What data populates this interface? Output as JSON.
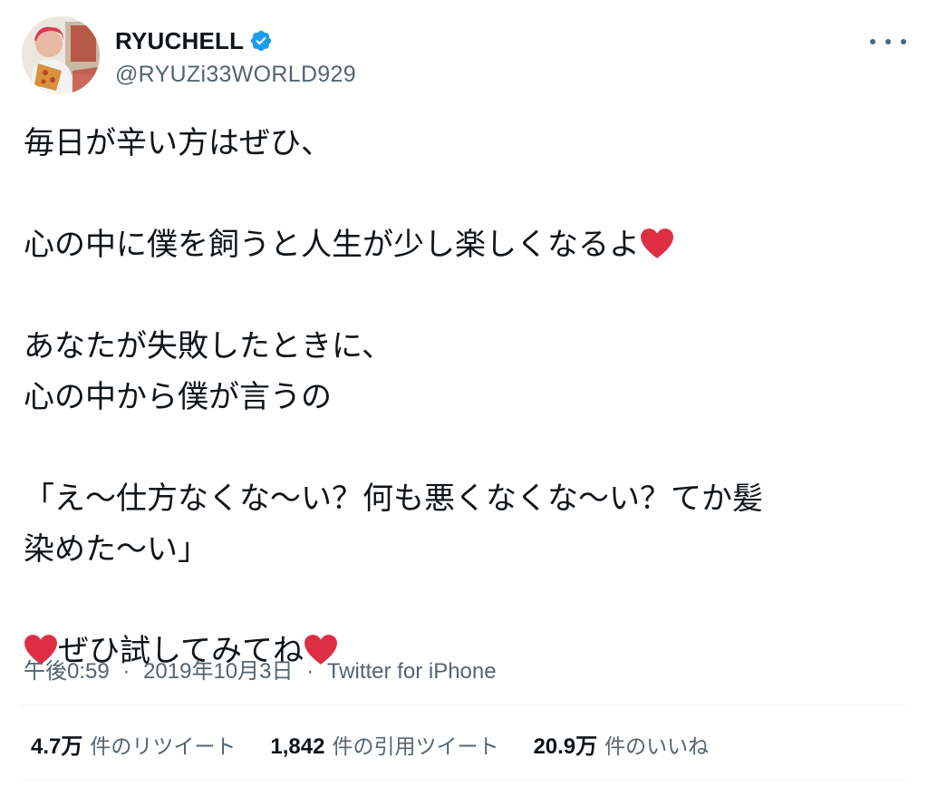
{
  "user": {
    "display_name": "RYUCHELL",
    "handle": "@RYUZi33WORLD929",
    "verified": true,
    "avatar_icon": "profile-photo",
    "verified_icon": "verified-badge-icon",
    "more_icon": "more-options-icon"
  },
  "tweet": {
    "lines": [
      {
        "text": "毎日が辛い方はぜひ、",
        "heart_before": false,
        "heart_after": false
      },
      {
        "text": "",
        "heart_before": false,
        "heart_after": false
      },
      {
        "text": "心の中に僕を飼うと人生が少し楽しくなるよ",
        "heart_before": false,
        "heart_after": true
      },
      {
        "text": "",
        "heart_before": false,
        "heart_after": false
      },
      {
        "text": "あなたが失敗したときに、",
        "heart_before": false,
        "heart_after": false
      },
      {
        "text": "心の中から僕が言うの",
        "heart_before": false,
        "heart_after": false
      },
      {
        "text": "",
        "heart_before": false,
        "heart_after": false
      },
      {
        "text": "「え〜仕方なくな〜い？何も悪くなくな〜い？てか髪",
        "heart_before": false,
        "heart_after": false
      },
      {
        "text": "染めた〜い」",
        "heart_before": false,
        "heart_after": false
      },
      {
        "text": "",
        "heart_before": false,
        "heart_after": false
      },
      {
        "text": "ぜひ試してみてね",
        "heart_before": true,
        "heart_after": true
      }
    ],
    "heart_icon": "red-heart-emoji",
    "heart_color": "#dd2e44"
  },
  "meta": {
    "time": "午後0:59",
    "separator": "·",
    "date": "2019年10月3日",
    "source": "Twitter for iPhone"
  },
  "stats": [
    {
      "count": "4.7万",
      "label": "件のリツイート"
    },
    {
      "count": "1,842",
      "label": "件の引用ツイート"
    },
    {
      "count": "20.9万",
      "label": "件のいいね"
    }
  ],
  "colors": {
    "text_primary": "#0f1419",
    "text_secondary": "#536471",
    "verified_blue": "#1d9bf0",
    "divider": "#eff3f4"
  }
}
